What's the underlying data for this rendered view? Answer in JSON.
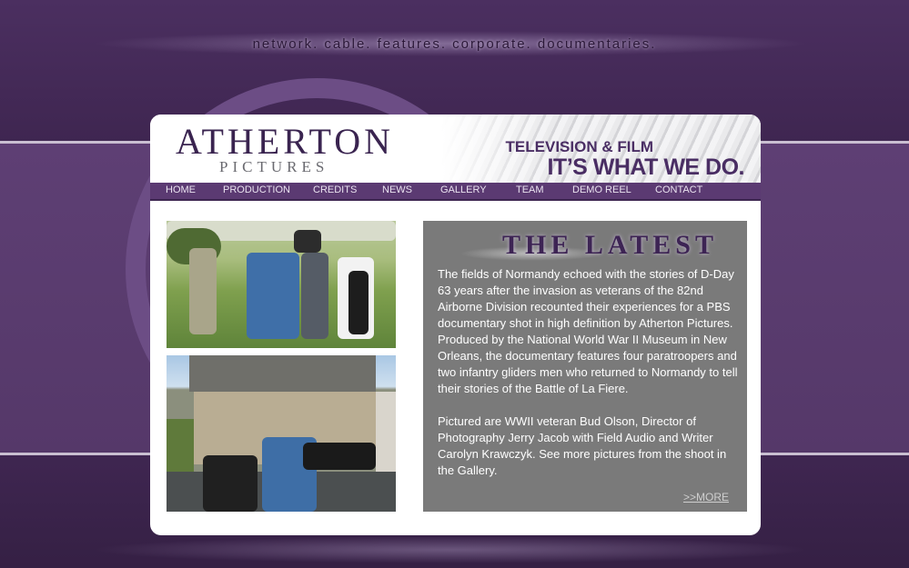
{
  "tagline": "network. cable. features. corporate. documentaries.",
  "logo": {
    "main": "ATHERTON",
    "sub": "PICTURES"
  },
  "header": {
    "line1": "TELEVISION & FILM",
    "line2": "IT’S WHAT WE DO."
  },
  "nav": [
    "HOME",
    "PRODUCTION",
    "CREDITS",
    "NEWS",
    "GALLERY",
    "TEAM",
    "DEMO REEL",
    "CONTACT"
  ],
  "latest": {
    "title": "THE LATEST",
    "paragraph1": "The fields of Normandy echoed with the stories of D-Day 63 years after the invasion as veterans of the 82nd Airborne Division recounted their experiences for a PBS documentary shot in high definition by Atherton Pictures. Produced by the National World War II Museum in New Orleans, the documentary features four paratroopers and two infantry gliders men who returned to Normandy to tell their stories of the Battle of La Fiere.",
    "paragraph2": "Pictured are WWII veteran Bud Olson, Director of Photography Jerry Jacob with Field Audio and Writer Carolyn Krawczyk. See more pictures from the shoot in the Gallery.",
    "more": ">>MORE"
  },
  "colors": {
    "brand_purple": "#4a2e64",
    "nav_bg": "#5b3a72",
    "latest_bg": "#7a7a7a"
  }
}
